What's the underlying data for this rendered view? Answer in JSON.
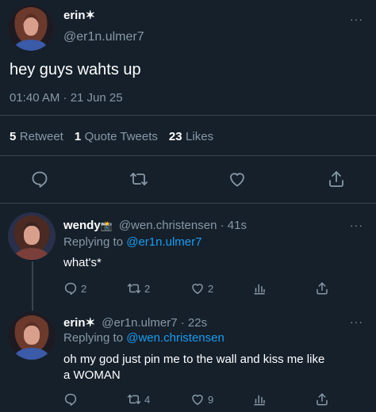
{
  "main_tweet": {
    "display_name": "erin",
    "name_badge": "✶",
    "handle": "@er1n.ulmer7",
    "text": "hey guys wahts up",
    "timestamp": "01:40 AM · 21 Jun 25",
    "stats": {
      "retweets_count": "5",
      "retweets_label": "Retweet",
      "quotes_count": "1",
      "quotes_label": "Quote Tweets",
      "likes_count": "23",
      "likes_label": "Likes"
    },
    "actions": [
      "reply-icon",
      "retweet-icon",
      "like-icon",
      "share-icon"
    ]
  },
  "replies": [
    {
      "display_name": "wendy",
      "name_badge": "📸",
      "handle": "@wen.christensen",
      "time_ago": "· 41s",
      "replying_prefix": "Replying to",
      "replying_to": "@er1n.ulmer7",
      "text": "what's*",
      "reply_count": "2",
      "retweet_count": "2",
      "like_count": "2"
    },
    {
      "display_name": "erin",
      "name_badge": "✶",
      "handle": "@er1n.ulmer7",
      "time_ago": "· 22s",
      "replying_prefix": "Replying to",
      "replying_to": "@wen.christensen",
      "text_line1": "oh my god just pin me to the wall and kiss me like",
      "text_line2": "a WOMAN",
      "retweet_count": "4",
      "like_count": "9"
    }
  ],
  "more_menu": "···",
  "colors": {
    "background": "#15202b",
    "muted": "#8899a6",
    "link": "#1d9bf0",
    "divider": "#38444d"
  }
}
